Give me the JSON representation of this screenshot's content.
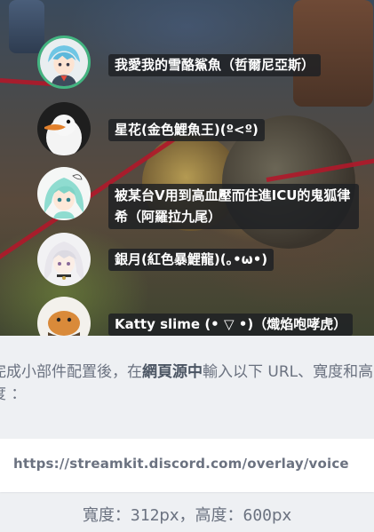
{
  "overlay": {
    "users": [
      {
        "name": "我愛我的雪酪鯊魚（哲爾尼亞斯）",
        "speaking": true,
        "avatar_icon": "anime-boy-avatar-icon"
      },
      {
        "name": "星花(金色鯉魚王)(º<º)",
        "speaking": false,
        "avatar_icon": "goose-avatar-icon"
      },
      {
        "name": "被某台V用到高血壓而住進ICU的鬼狐律希（阿羅拉九尾）",
        "speaking": false,
        "avatar_icon": "anime-girl-avatar-icon"
      },
      {
        "name": "銀月(紅色暴鯉龍)(｡•ω•)",
        "speaking": false,
        "avatar_icon": "white-hair-avatar-icon"
      },
      {
        "name": "Katty slime (• ▽ •)（熾焰咆哮虎）",
        "speaking": false,
        "avatar_icon": "slime-avatar-icon"
      }
    ],
    "speaking_color": "#43b581"
  },
  "instructions": {
    "prefix": "完成小部件配置後，在",
    "emphasis": "網頁源中",
    "suffix": "輸入以下 URL、寬度和高度 ："
  },
  "url": {
    "value": "https://streamkit.discord.com/overlay/voice"
  },
  "dimensions": {
    "width_label": "寬度：",
    "width_value": "312",
    "width_unit": "px，",
    "height_label": "高度：",
    "height_value": "600",
    "height_unit": "px"
  }
}
